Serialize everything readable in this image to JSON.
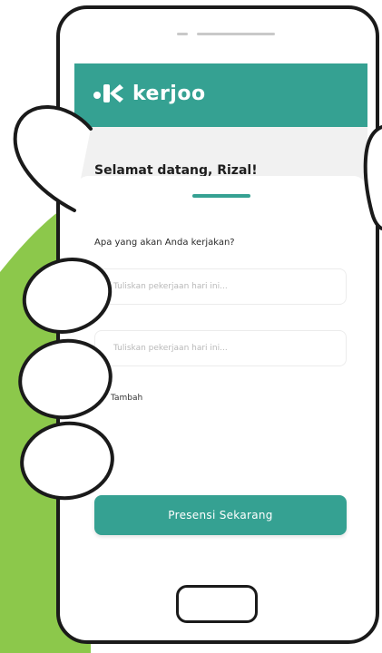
{
  "colors": {
    "accent": "#35a192",
    "background_green": "#8cc84b",
    "outline": "#1a1a1a"
  },
  "app": {
    "brand": "kerjoo",
    "logo_icon": "kerjoo-logo-icon"
  },
  "header": {
    "greeting": "Selamat datang, Rizal!"
  },
  "sheet": {
    "question": "Apa yang akan Anda kerjakan?",
    "fields": [
      {
        "placeholder": "Tuliskan pekerjaan hari ini..."
      },
      {
        "placeholder": "Tuliskan pekerjaan hari ini..."
      }
    ],
    "add_label": "Tambah",
    "submit_label": "Presensi Sekarang"
  }
}
